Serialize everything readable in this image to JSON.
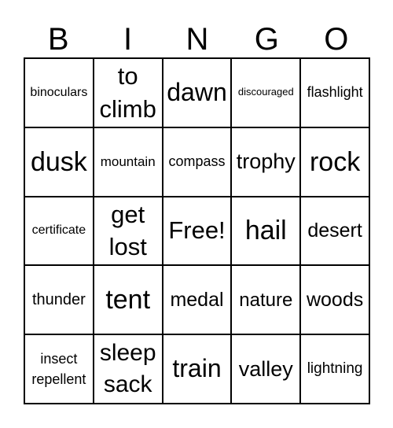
{
  "header": [
    "B",
    "I",
    "N",
    "G",
    "O"
  ],
  "cells": [
    "binoculars",
    "to climb",
    "dawn",
    "discouraged",
    "flashlight",
    "dusk",
    "mountain",
    "compass",
    "trophy",
    "rock",
    "certificate",
    "get lost",
    "Free!",
    "hail",
    "desert",
    "thunder",
    "tent",
    "medal",
    "nature",
    "woods",
    "insect repellent",
    "sleep sack",
    "train",
    "valley",
    "lightning"
  ]
}
